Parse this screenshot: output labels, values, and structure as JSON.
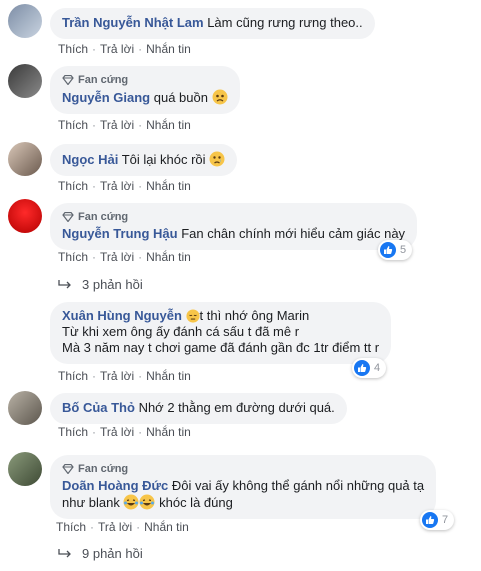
{
  "actions": {
    "like": "Thích",
    "reply": "Trả lời",
    "message": "Nhắn tin",
    "sep": "·"
  },
  "fan_badge": "Fan cứng",
  "comments": [
    {
      "name": "Trần Nguyễn Nhật Lam",
      "text": "Làm cũng rưng rưng theo.."
    },
    {
      "name": "Nguyễn Giang",
      "text": "quá buồn",
      "emoji": "sad-face-emoji"
    },
    {
      "name": "Ngọc Hải",
      "text": "Tôi lại khóc rồi",
      "emoji": "crying-face-emoji"
    },
    {
      "name": "Nguyễn Trung Hậu",
      "text": "Fan chân chính mới hiểu cảm giác này",
      "reactions": "5"
    },
    {
      "name": "Xuân Hùng Nguyễn",
      "text_line1": "t thì nhớ ông Marin",
      "text_line2": "Từ khi xem ông ấy đánh cá sấu t đã mê r",
      "text_line3": "Mà 3 năm nay t chơi game đã đánh gần đc 1tr điểm tt r",
      "emoji": "pensive-face-emoji",
      "reactions": "4"
    },
    {
      "name": "Bố Của Thỏ",
      "text": "Nhớ 2 thằng em đường dưới quá."
    },
    {
      "name": "Doãn Hoàng Đức",
      "text_line1": "Đôi vai ấy không thể gánh nổi những quả tạ",
      "text_line2_a": "như blank",
      "text_line2_b": "khóc là đúng",
      "emoji": "laughing-tears-emoji",
      "reactions": "7"
    }
  ],
  "replies_1": "3 phản hồi",
  "replies_2": "9 phản hồi",
  "colors": {
    "name": "#385898",
    "bubble": "#f2f3f5",
    "like": "#1877f2"
  }
}
